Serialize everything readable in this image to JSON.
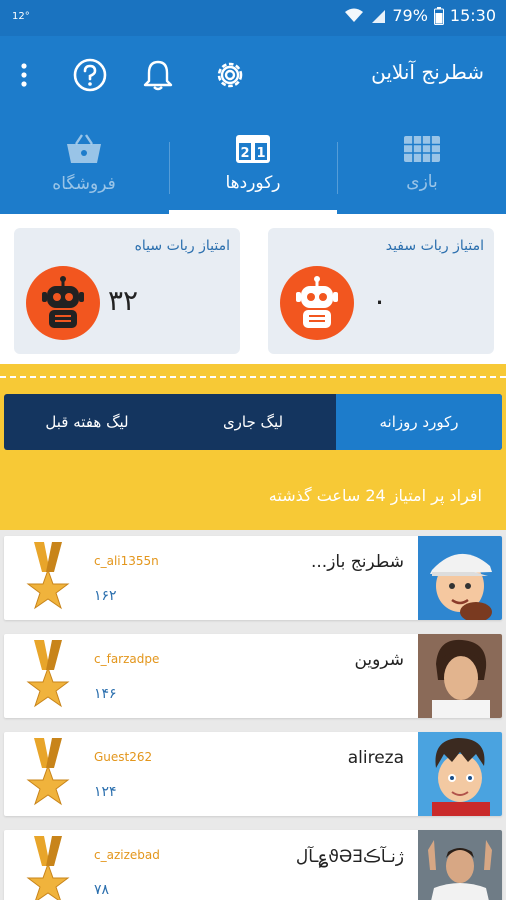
{
  "status_bar": {
    "left": "12°",
    "battery": "79%",
    "time": "15:30"
  },
  "app_bar": {
    "title": "شطرنج آنلاین"
  },
  "tabs": [
    {
      "label": "فروشگاه",
      "icon": "basket-icon"
    },
    {
      "label": "رکوردها",
      "icon": "scoreboard-icon",
      "active": true
    },
    {
      "label": "بازی",
      "icon": "grid-icon"
    }
  ],
  "scores": {
    "black": {
      "label": "امتیاز ربات سیاه",
      "value": "۳۲"
    },
    "white": {
      "label": "امتیاز ربات سفید",
      "value": "۰"
    }
  },
  "segments": [
    {
      "label": "لیگ هفته قبل"
    },
    {
      "label": "لیگ جاری"
    },
    {
      "label": "رکورد روزانه",
      "active": true
    }
  ],
  "list_title": "افراد پر امتیاز 24 ساعت گذشته",
  "players": [
    {
      "name": "شطرنج باز...",
      "username": "c_ali1355n",
      "score": "۱۶۲"
    },
    {
      "name": "شروین",
      "username": "c_farzadpe",
      "score": "۱۴۶"
    },
    {
      "name": "alireza",
      "username": "Guest262",
      "score": "۱۲۴"
    },
    {
      "name": "ژنـآڪϑƏƎ؏ـآل",
      "username": "c_azizebad",
      "score": "۷۸"
    }
  ],
  "colors": {
    "primary": "#1d7ccb",
    "navy": "#14355f",
    "yellow": "#f7c936",
    "orange": "#f2561f",
    "gold": "#e3961c"
  }
}
